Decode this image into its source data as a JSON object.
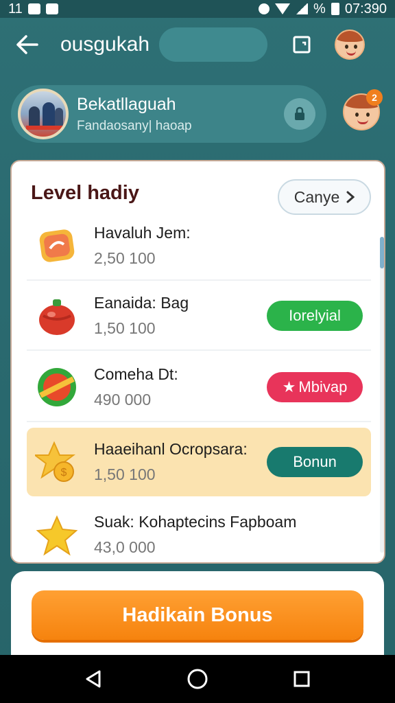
{
  "status_bar": {
    "left_text": "11",
    "time": "07:390",
    "battery_text": "%"
  },
  "app_bar": {
    "title": "ousgukah"
  },
  "profile": {
    "name": "Bekatllaguah",
    "subtitle": "Fandaosany| haoap"
  },
  "side_avatar": {
    "badge": "2"
  },
  "card": {
    "title": "Level hadiy",
    "filter_label": "Canye",
    "items": [
      {
        "name": "Havaluh Jem:",
        "value": "2,50 100",
        "icon": "candy-icon",
        "action": null
      },
      {
        "name": "Eanaida: Bag",
        "value": "1,50 100",
        "icon": "red-bag-icon",
        "action": {
          "label": "Iorelyial",
          "color": "#2bb34a"
        }
      },
      {
        "name": "Comeha Dt:",
        "value": "490 000",
        "icon": "ball-icon",
        "action": {
          "label": "Mbivap",
          "color": "#e8345a"
        }
      },
      {
        "name": "Haaeihanl Ocropsara:",
        "value": "1,50 100",
        "icon": "coin-star-icon",
        "action": {
          "label": "Bonun",
          "color": "#187a6e"
        },
        "highlight": true
      },
      {
        "name": "Suak: Kohaptecins Fapboam",
        "value": "43,0 000",
        "icon": "star-icon",
        "action": null
      }
    ]
  },
  "bottom": {
    "cta_label": "Hadikain Bonus"
  }
}
